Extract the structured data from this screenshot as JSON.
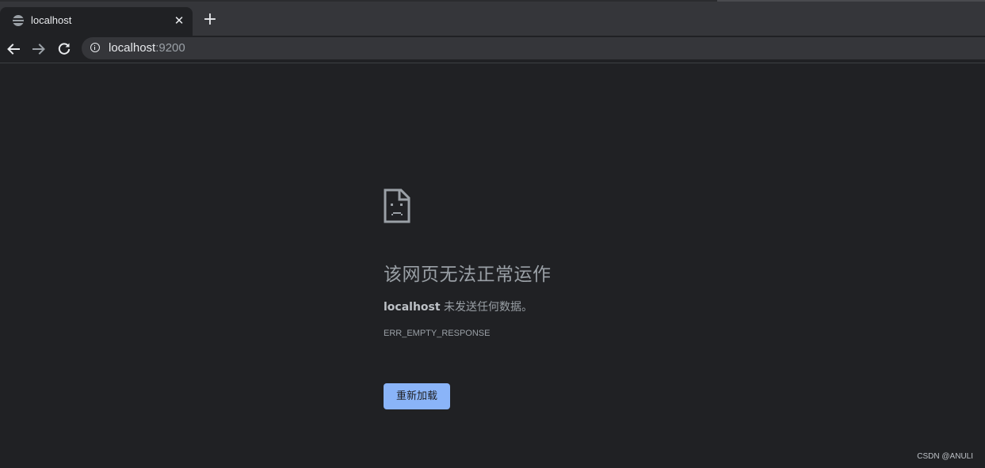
{
  "tab": {
    "title": "localhost",
    "favicon": "globe-icon",
    "close": "close-icon",
    "new_tab": "plus-icon"
  },
  "toolbar": {
    "back": "arrow-left-icon",
    "forward": "arrow-right-icon",
    "reload": "reload-icon",
    "site_info": "info-icon",
    "url_host": "localhost",
    "url_port": ":9200"
  },
  "error_page": {
    "icon": "sad-document-icon",
    "heading": "该网页无法正常运作",
    "summary_host": "localhost",
    "summary_text": " 未发送任何数据。",
    "error_code": "ERR_EMPTY_RESPONSE",
    "reload_button": "重新加载"
  },
  "watermark": "CSDN @ANULI",
  "colors": {
    "page_background": "#202124",
    "tab_strip": "#35363a",
    "text_primary": "#e8eaed",
    "text_secondary": "#9aa0a6",
    "button_accent": "#8ab4f8"
  }
}
